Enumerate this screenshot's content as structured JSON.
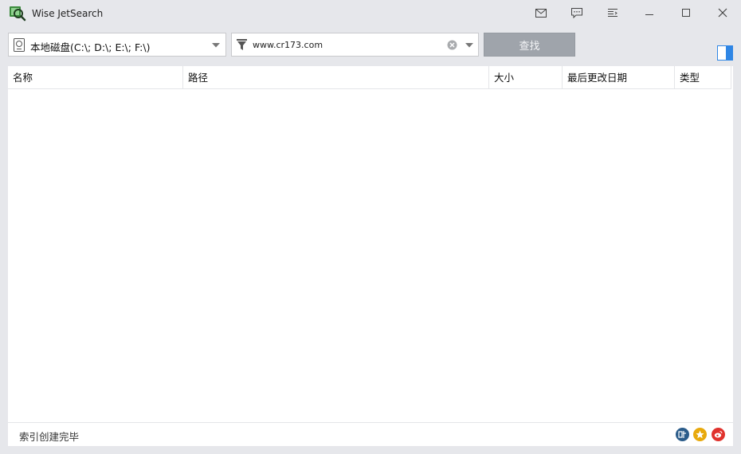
{
  "app": {
    "title": "Wise JetSearch"
  },
  "titlebar": {
    "icons": [
      "mail-icon",
      "feedback-icon",
      "menu-icon",
      "minimize-icon",
      "maximize-icon",
      "close-icon"
    ]
  },
  "toolbar": {
    "drive_selected": "本地磁盘(C:\\; D:\\; E:\\; F:\\)",
    "search_value": "www.cr173.com",
    "search_button_label": "查找"
  },
  "table": {
    "columns": [
      "名称",
      "路径",
      "大小",
      "最后更改日期",
      "类型"
    ],
    "rows": []
  },
  "status": {
    "text": "索引创建完毕"
  },
  "colors": {
    "window_bg": "#e6e7eb",
    "button_bg": "#9fa4ab",
    "accent_blue": "#2f86e5",
    "social_blue": "#2b5c8a",
    "social_yellow": "#e8a90c",
    "social_red": "#e0322d"
  }
}
